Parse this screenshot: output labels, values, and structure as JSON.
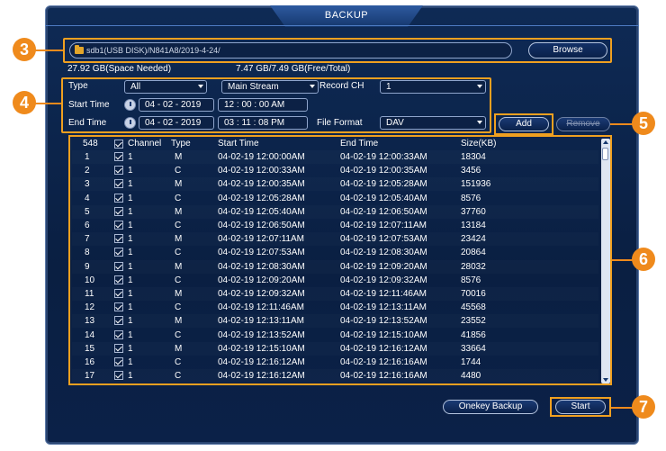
{
  "window": {
    "title": "BACKUP"
  },
  "path": {
    "value": "sdb1(USB DISK)/N841A8/2019-4-24/",
    "browse_label": "Browse"
  },
  "space": {
    "needed": "27.92 GB(Space Needed)",
    "free_total": "7.47 GB/7.49 GB(Free/Total)"
  },
  "filters": {
    "type_label": "Type",
    "type_value": "All",
    "stream_value": "Main Stream",
    "record_ch_label": "Record CH",
    "record_ch_value": "1",
    "start_label": "Start Time",
    "start_date": "04 - 02 - 2019",
    "start_time": "12 : 00 : 00  AM",
    "end_label": "End Time",
    "end_date": "04 - 02 - 2019",
    "end_time": "03 : 11 : 08  PM",
    "format_label": "File Format",
    "format_value": "DAV"
  },
  "buttons": {
    "add": "Add",
    "remove": "Remove",
    "onekey": "Onekey Backup",
    "start": "Start"
  },
  "table": {
    "count": "548",
    "headers": {
      "channel": "Channel",
      "type": "Type",
      "start": "Start Time",
      "end": "End Time",
      "size": "Size(KB)"
    },
    "rows": [
      {
        "no": "1",
        "ch": "1",
        "type": "M",
        "start": "04-02-19 12:00:00AM",
        "end": "04-02-19 12:00:33AM",
        "size": "18304"
      },
      {
        "no": "2",
        "ch": "1",
        "type": "C",
        "start": "04-02-19 12:00:33AM",
        "end": "04-02-19 12:00:35AM",
        "size": "3456"
      },
      {
        "no": "3",
        "ch": "1",
        "type": "M",
        "start": "04-02-19 12:00:35AM",
        "end": "04-02-19 12:05:28AM",
        "size": "151936"
      },
      {
        "no": "4",
        "ch": "1",
        "type": "C",
        "start": "04-02-19 12:05:28AM",
        "end": "04-02-19 12:05:40AM",
        "size": "8576"
      },
      {
        "no": "5",
        "ch": "1",
        "type": "M",
        "start": "04-02-19 12:05:40AM",
        "end": "04-02-19 12:06:50AM",
        "size": "37760"
      },
      {
        "no": "6",
        "ch": "1",
        "type": "C",
        "start": "04-02-19 12:06:50AM",
        "end": "04-02-19 12:07:11AM",
        "size": "13184"
      },
      {
        "no": "7",
        "ch": "1",
        "type": "M",
        "start": "04-02-19 12:07:11AM",
        "end": "04-02-19 12:07:53AM",
        "size": "23424"
      },
      {
        "no": "8",
        "ch": "1",
        "type": "C",
        "start": "04-02-19 12:07:53AM",
        "end": "04-02-19 12:08:30AM",
        "size": "20864"
      },
      {
        "no": "9",
        "ch": "1",
        "type": "M",
        "start": "04-02-19 12:08:30AM",
        "end": "04-02-19 12:09:20AM",
        "size": "28032"
      },
      {
        "no": "10",
        "ch": "1",
        "type": "C",
        "start": "04-02-19 12:09:20AM",
        "end": "04-02-19 12:09:32AM",
        "size": "8576"
      },
      {
        "no": "11",
        "ch": "1",
        "type": "M",
        "start": "04-02-19 12:09:32AM",
        "end": "04-02-19 12:11:46AM",
        "size": "70016"
      },
      {
        "no": "12",
        "ch": "1",
        "type": "C",
        "start": "04-02-19 12:11:46AM",
        "end": "04-02-19 12:13:11AM",
        "size": "45568"
      },
      {
        "no": "13",
        "ch": "1",
        "type": "M",
        "start": "04-02-19 12:13:11AM",
        "end": "04-02-19 12:13:52AM",
        "size": "23552"
      },
      {
        "no": "14",
        "ch": "1",
        "type": "C",
        "start": "04-02-19 12:13:52AM",
        "end": "04-02-19 12:15:10AM",
        "size": "41856"
      },
      {
        "no": "15",
        "ch": "1",
        "type": "M",
        "start": "04-02-19 12:15:10AM",
        "end": "04-02-19 12:16:12AM",
        "size": "33664"
      },
      {
        "no": "16",
        "ch": "1",
        "type": "C",
        "start": "04-02-19 12:16:12AM",
        "end": "04-02-19 12:16:16AM",
        "size": "1744"
      },
      {
        "no": "17",
        "ch": "1",
        "type": "C",
        "start": "04-02-19 12:16:12AM",
        "end": "04-02-19 12:16:16AM",
        "size": "4480"
      }
    ]
  },
  "callouts": {
    "c3": "3",
    "c4": "4",
    "c5": "5",
    "c6": "6",
    "c7": "7"
  },
  "colors": {
    "accent": "#ef8a1c",
    "background": "#0e2a55"
  },
  "icons": {
    "path": "folder-icon",
    "time": "clock-icon",
    "row_check": "checkbox-checked-icon"
  }
}
